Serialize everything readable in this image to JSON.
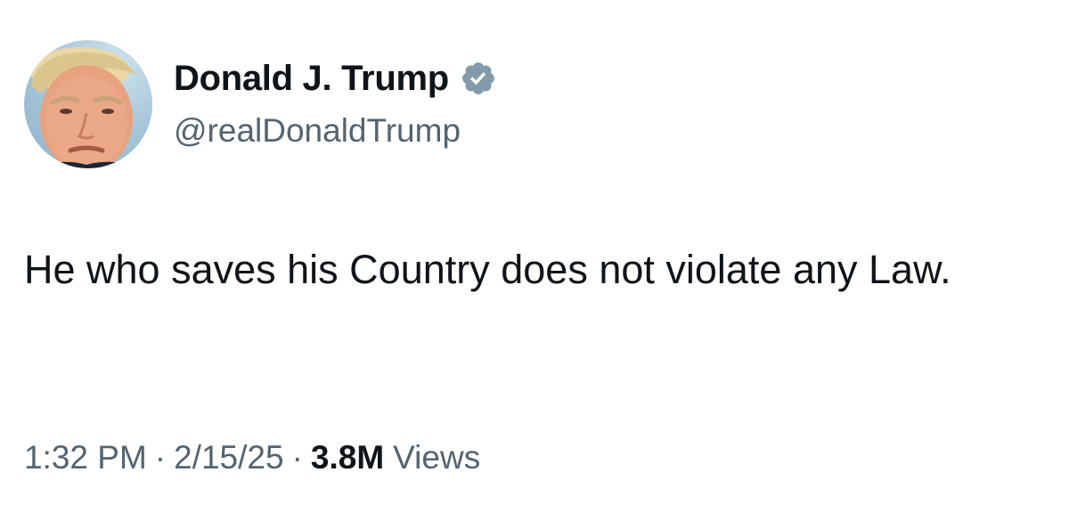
{
  "author": {
    "display_name": "Donald J. Trump",
    "handle": "@realDonaldTrump",
    "verified": true,
    "badge_color": "#829aab",
    "avatar_icon": "profile-photo"
  },
  "tweet": {
    "text": "He who saves his Country does not violate any Law."
  },
  "meta": {
    "time": "1:32 PM",
    "date": "2/15/25",
    "separator": "·",
    "views_count": "3.8M",
    "views_label": "Views"
  },
  "colors": {
    "primary_text": "#0f1419",
    "secondary_text": "#536471",
    "background": "#ffffff"
  }
}
